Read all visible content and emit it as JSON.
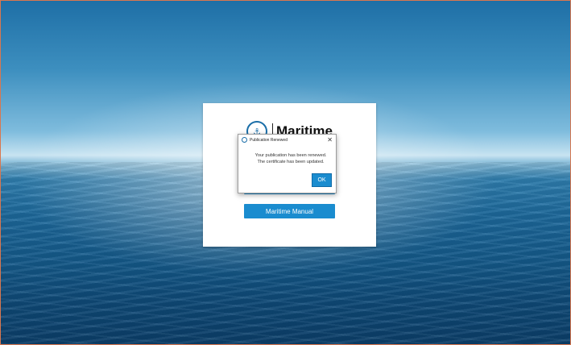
{
  "app": {
    "logo_text": "Maritime",
    "primary_button_label": "Maritime Manual"
  },
  "dialog": {
    "title": "Publication Renewed",
    "message_line1": "Your publication has been renewed.",
    "message_line2": "The certificate has been updated.",
    "ok_label": "OK",
    "close_glyph": "✕"
  },
  "colors": {
    "accent": "#1a8ccf",
    "window_border": "#d9774f"
  }
}
